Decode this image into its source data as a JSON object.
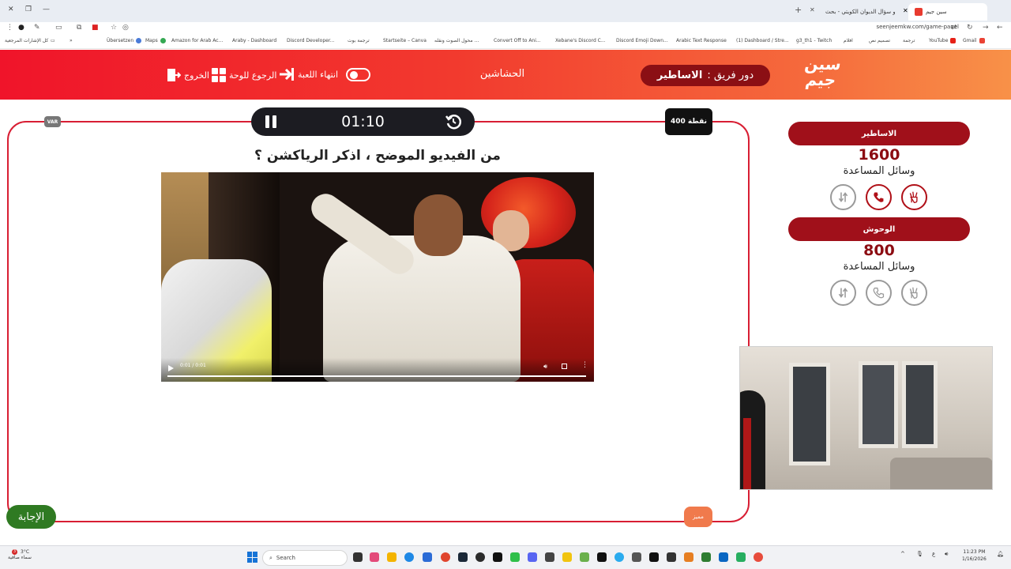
{
  "browser": {
    "tabs": [
      {
        "label": "سين جيم",
        "active": true
      },
      {
        "label": "البيبرو سؤال الديوان الكويتي - بحث",
        "active": false
      }
    ],
    "new_tab": "+",
    "url": "seenjeemkw.com/game-panel",
    "bookmarks": [
      "Übersetzen",
      "Maps",
      "Amazon for Arab Ac...",
      "Araby - Dashboard",
      "Discord Developer...",
      "ترجمة بوت",
      "Startseite – Canva",
      "محول الصوت ونقله ...",
      "Convert Off to Ani...",
      "Xebane's Discord C...",
      "Discord Emoji Down...",
      "Arabic Text Response",
      "(1) Dashboard / Stre...",
      "g3_th1 - Twitch",
      "افلام",
      "تصميم نص",
      "ترجمة",
      "YouTube",
      "Gmail"
    ],
    "bookmarks_left": "كل الإشارات المرجعية"
  },
  "header": {
    "logo_lines": [
      "سين",
      "جيم"
    ],
    "turn_prefix": "دور فريق :",
    "turn_team": "الاساطير",
    "game_name": "الحشاشين",
    "end_game_label": "انتهاء اللعبة",
    "back_to_board_label": "الرجوع للوحة",
    "exit_label": "الخروج"
  },
  "question": {
    "timer": "01:10",
    "points": "400 نقطة",
    "badge": "VAR",
    "text": "من الفيديو الموضح ، اذكر الرياكشن ؟",
    "video_time": "0:01 / 0:01",
    "answer_label": "الإجابة",
    "special_label": "مميز"
  },
  "teams": [
    {
      "name": "الاساطير",
      "score": "1600",
      "aids_label": "وسائل المساعدة",
      "aids": [
        {
          "icon": "two-answers-icon",
          "used": true
        },
        {
          "icon": "phone-icon",
          "used": true
        },
        {
          "icon": "swap-icon",
          "used": false
        }
      ]
    },
    {
      "name": "الوحوش",
      "score": "800",
      "aids_label": "وسائل المساعدة",
      "aids": [
        {
          "icon": "two-answers-icon",
          "used": false
        },
        {
          "icon": "phone-icon",
          "used": false
        },
        {
          "icon": "swap-icon",
          "used": false
        }
      ]
    }
  ],
  "taskbar": {
    "weather_temp": "3°C",
    "weather_desc": "سماء صافية",
    "notification_count": "3",
    "search_placeholder": "Search",
    "time": "11:23 PM",
    "date": "1/16/2026",
    "lang": "ع"
  },
  "colors": {
    "primary_red": "#d81e33",
    "dark_red": "#8b0f14",
    "answer_green": "#2f7a22"
  }
}
